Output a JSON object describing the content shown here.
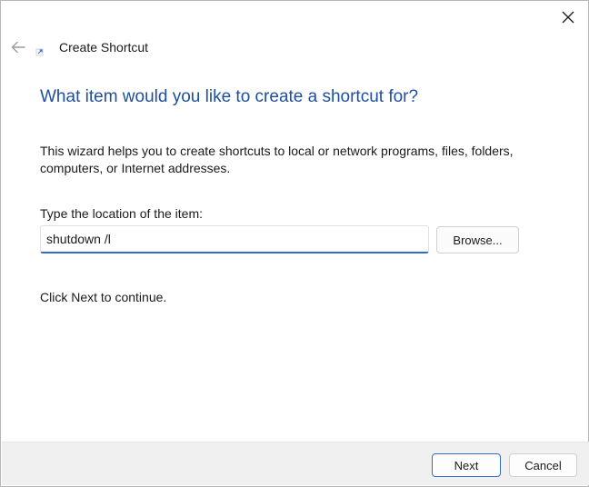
{
  "window": {
    "title": "Create Shortcut"
  },
  "icons": {
    "close": "close-icon",
    "back": "back-arrow-icon",
    "shortcut": "shortcut-icon"
  },
  "wizard": {
    "heading": "What item would you like to create a shortcut for?",
    "description": "This wizard helps you to create shortcuts to local or network programs, files, folders, computers, or Internet addresses.",
    "location_label": "Type the location of the item:",
    "location_value": "shutdown /l",
    "location_placeholder": "",
    "browse_label": "Browse...",
    "continue_text": "Click Next to continue."
  },
  "footer": {
    "next_label": "Next",
    "cancel_label": "Cancel"
  },
  "colors": {
    "heading": "#1f4fa0",
    "accent": "#2f6dc8",
    "footer_bg": "#f0f0f0"
  }
}
